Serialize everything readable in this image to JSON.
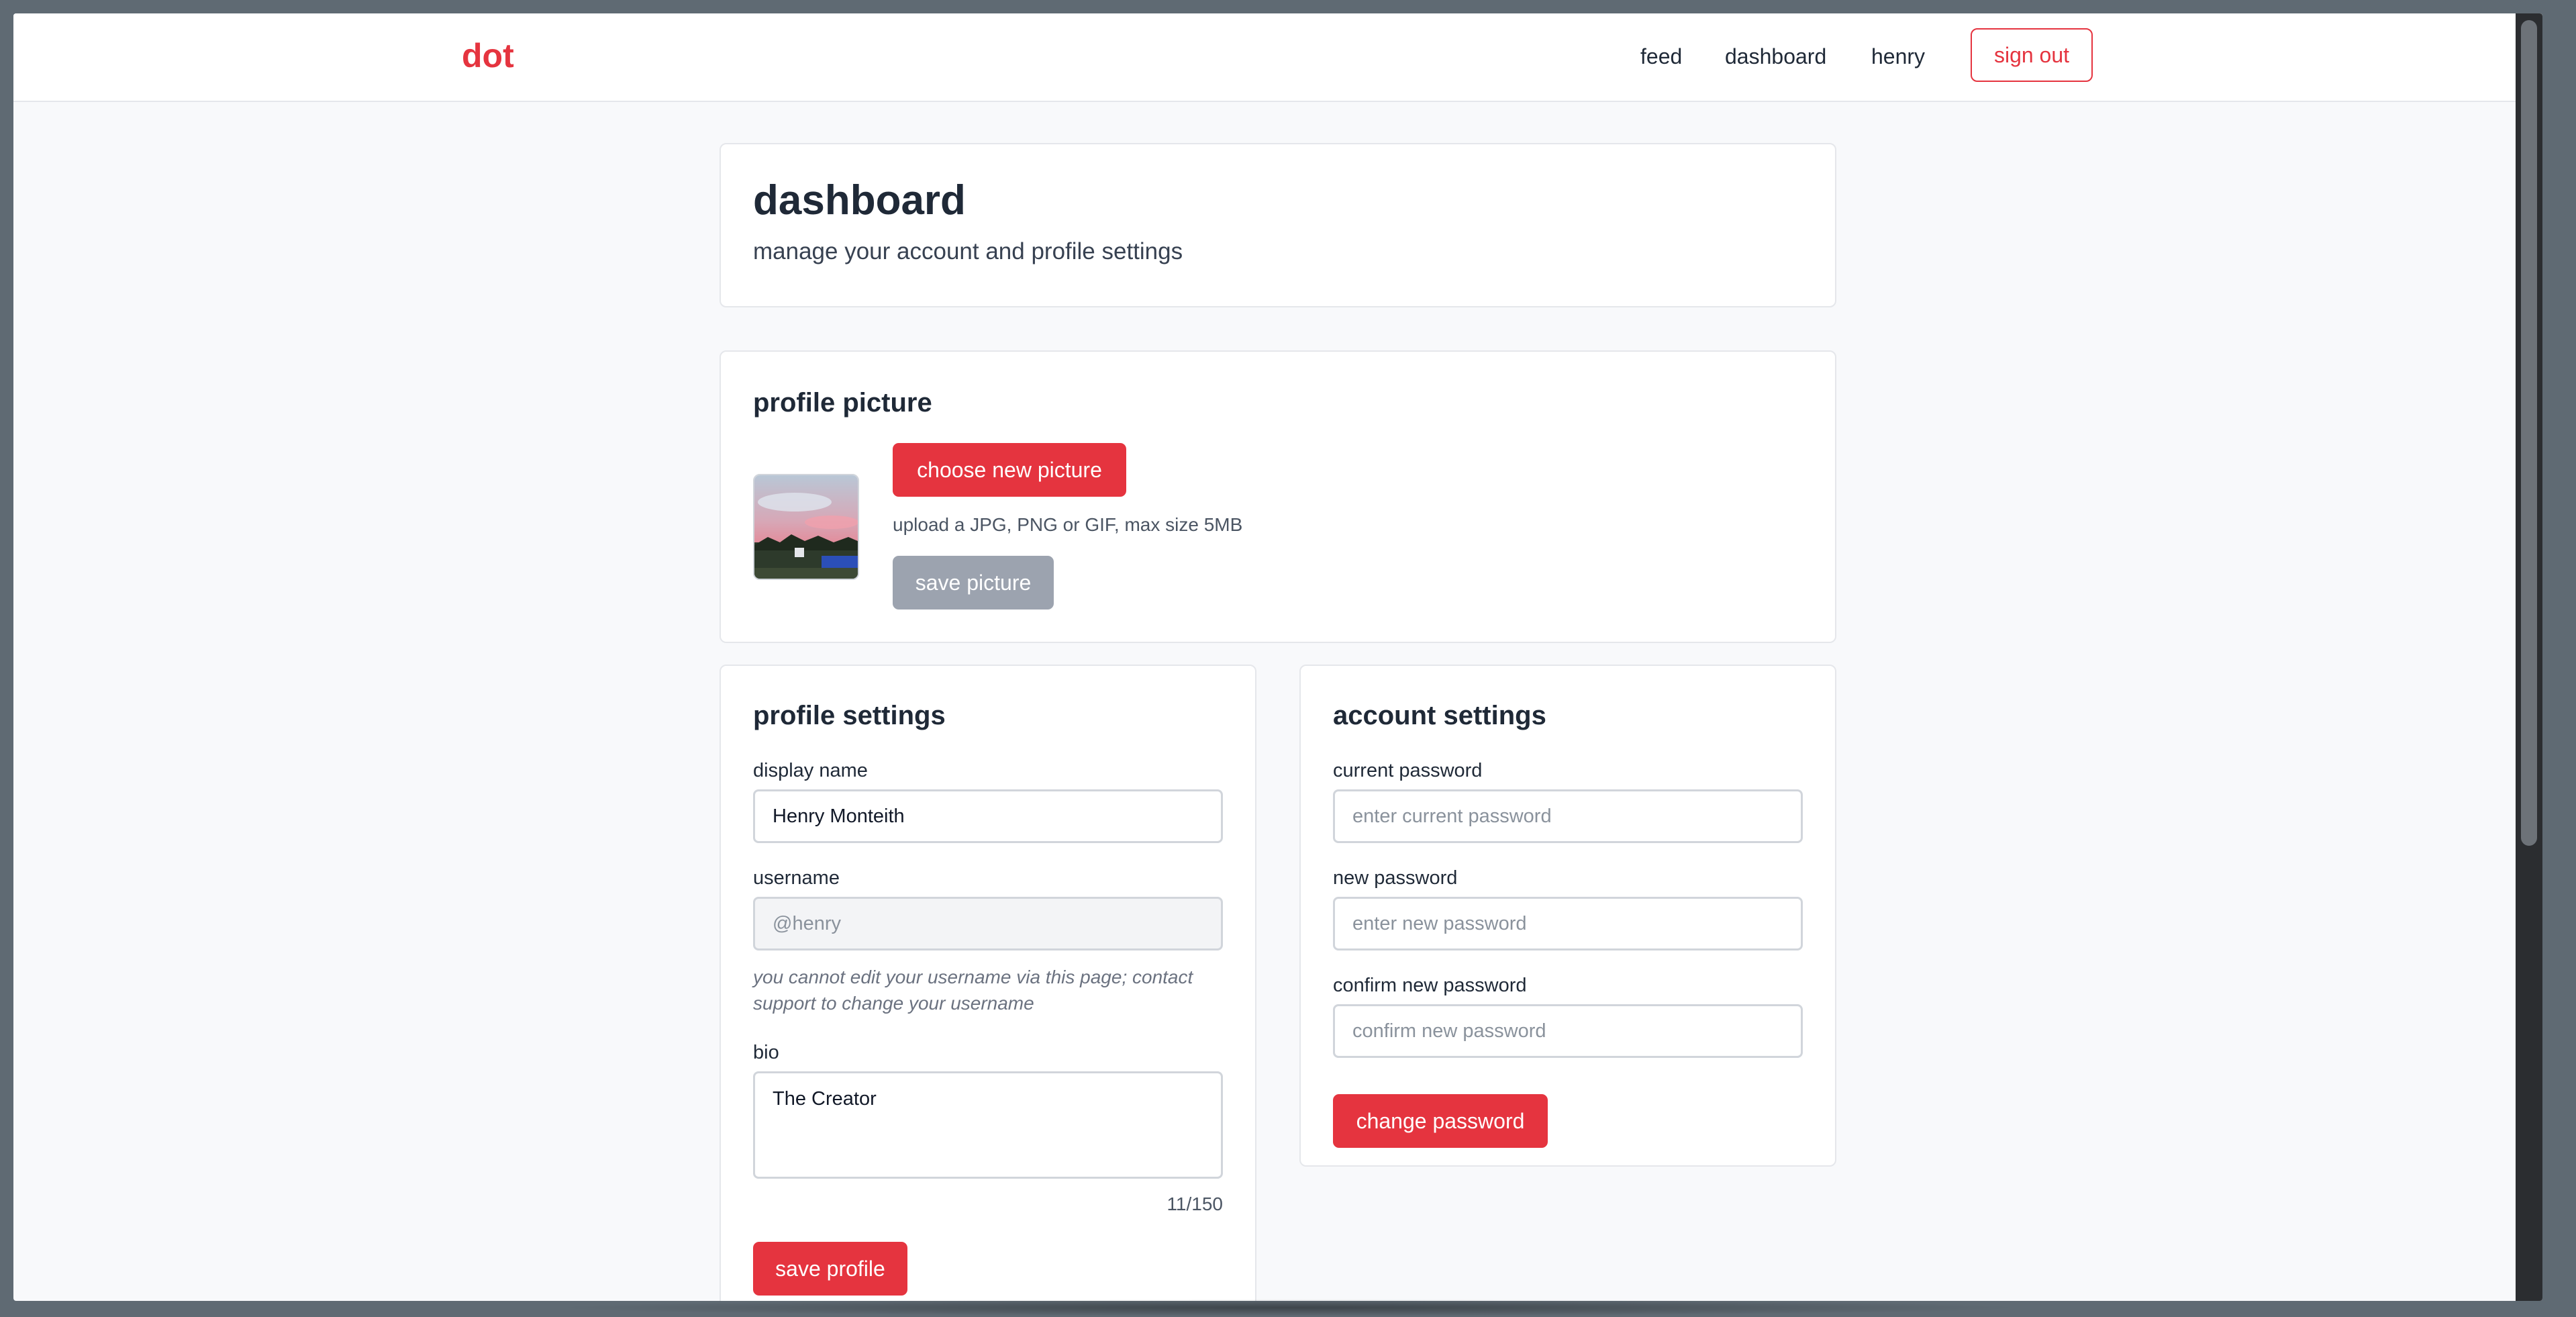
{
  "navbar": {
    "logo": "dot",
    "links": {
      "feed": "feed",
      "dashboard": "dashboard",
      "user": "henry"
    },
    "sign_out": "sign out"
  },
  "header": {
    "title": "dashboard",
    "subtitle": "manage your account and profile settings"
  },
  "profile_picture": {
    "title": "profile picture",
    "choose_button": "choose new picture",
    "hint": "upload a JPG, PNG or GIF, max size 5MB",
    "save_button": "save picture"
  },
  "profile_settings": {
    "title": "profile settings",
    "display_name_label": "display name",
    "display_name_value": "Henry Monteith",
    "username_label": "username",
    "username_value": "@henry",
    "username_hint": "you cannot edit your username via this page; contact support to change your username",
    "bio_label": "bio",
    "bio_value": "The Creator",
    "bio_counter": "11/150",
    "save_button": "save profile"
  },
  "account_settings": {
    "title": "account settings",
    "current_password_label": "current password",
    "current_password_placeholder": "enter current password",
    "new_password_label": "new password",
    "new_password_placeholder": "enter new password",
    "confirm_password_label": "confirm new password",
    "confirm_password_placeholder": "confirm new password",
    "change_button": "change password"
  },
  "colors": {
    "accent": "#e5343f",
    "disabled_button": "#9ca3af",
    "page_background": "#f8f9fb"
  }
}
